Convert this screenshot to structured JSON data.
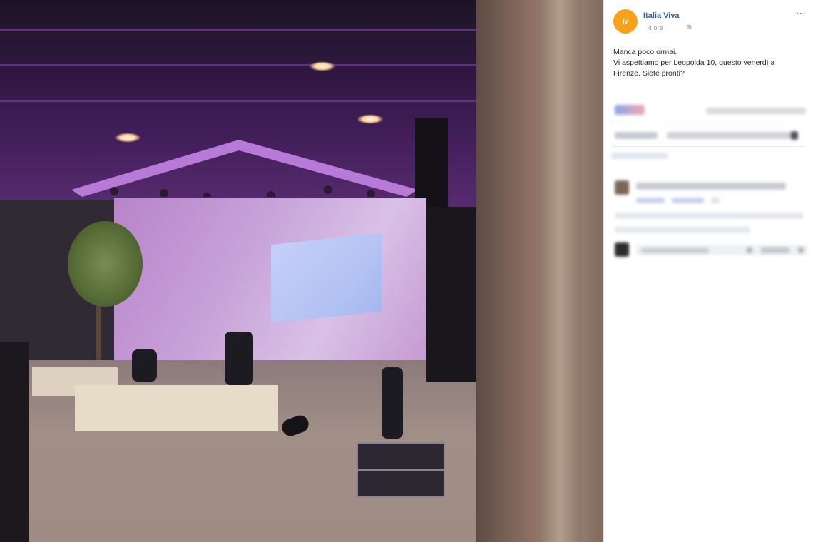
{
  "post": {
    "page_name": "Italia Viva",
    "avatar_text": "IV",
    "timestamp": "4 ore",
    "text_lines": [
      "Manca poco ormai.",
      "Vi aspettiamo per Leopolda 10, questo venerdì a",
      "Firenze. Siete pronti?"
    ],
    "more_icon": "⋯",
    "globe_icon": "⊕",
    "colors": {
      "link": "#365899",
      "avatar": "#f7a21a",
      "text": "#1d2129",
      "meta": "#90949c"
    }
  },
  "photo": {
    "description_icon": "stage-photo",
    "colors": {
      "ceiling": "#3c1b52",
      "screen": "#c7a2d9",
      "floor": "#9e8c85"
    }
  }
}
